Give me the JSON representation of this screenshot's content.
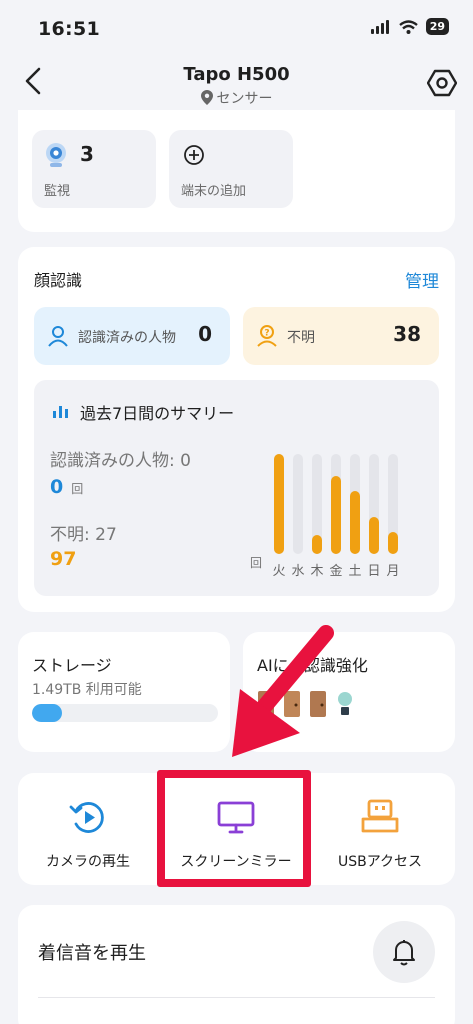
{
  "status": {
    "time": "16:51",
    "battery": "29"
  },
  "header": {
    "title": "Tapo H500",
    "subtitle": "センサー"
  },
  "devices": {
    "monitor": {
      "count": "3",
      "label": "監視"
    },
    "add": {
      "label": "端末の追加"
    }
  },
  "face": {
    "title": "顔認識",
    "manage": "管理",
    "known": {
      "label": "認識済みの人物",
      "value": "0"
    },
    "unknown": {
      "label": "不明",
      "value": "38"
    },
    "summary": {
      "title": "過去7日間のサマリー",
      "known_label": "認識済みの人物: 0",
      "known_value": "0",
      "unit": "回",
      "unknown_label": "不明: 27",
      "unknown_value": "97",
      "axis_unit": "回"
    }
  },
  "chart_data": {
    "type": "bar",
    "categories": [
      "火",
      "水",
      "木",
      "金",
      "土",
      "日",
      "月"
    ],
    "values": [
      27,
      0,
      5,
      21,
      17,
      10,
      6
    ],
    "ylim": [
      0,
      27
    ]
  },
  "storage": {
    "title": "ストレージ",
    "subtitle": "1.49TB 利用可能",
    "used_fraction": 0.16
  },
  "ai": {
    "title": "AIに...認識強化"
  },
  "actions": {
    "playback": "カメラの再生",
    "mirror": "スクリーンミラー",
    "usb": "USBアクセス"
  },
  "ringtone": {
    "title": "着信音を再生"
  },
  "colors": {
    "accent": "#1e88d8",
    "orange": "#f0a012",
    "highlight": "#e8123e",
    "purple": "#8a3fd6"
  }
}
